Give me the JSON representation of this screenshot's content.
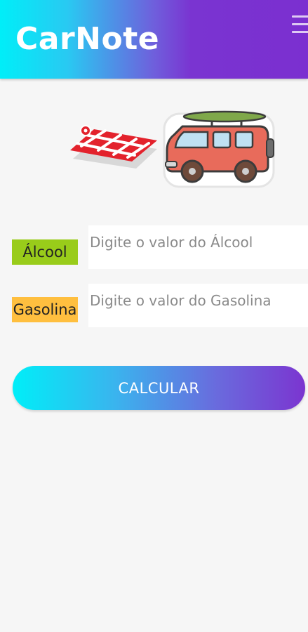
{
  "header": {
    "title": "CarNote",
    "menu_icon": "hamburger-menu-icon"
  },
  "illustration": {
    "map_icon": "city-map-icon",
    "vehicle_icon": "van-with-surfboard-icon"
  },
  "form": {
    "alcool": {
      "label": "Álcool",
      "placeholder": "Digite o valor do Álcool",
      "value": ""
    },
    "gasolina": {
      "label": "Gasolina",
      "placeholder": "Digite o valor do Gasolina",
      "value": ""
    },
    "calculate_label": "CALCULAR"
  },
  "colors": {
    "header_gradient_start": "#00eef8",
    "header_gradient_end": "#7b2fd0",
    "alcool_label_bg": "#99cc1a",
    "gasolina_label_bg": "#ffbf3f",
    "van_body": "#e86b5b",
    "map_red": "#e0202a"
  }
}
